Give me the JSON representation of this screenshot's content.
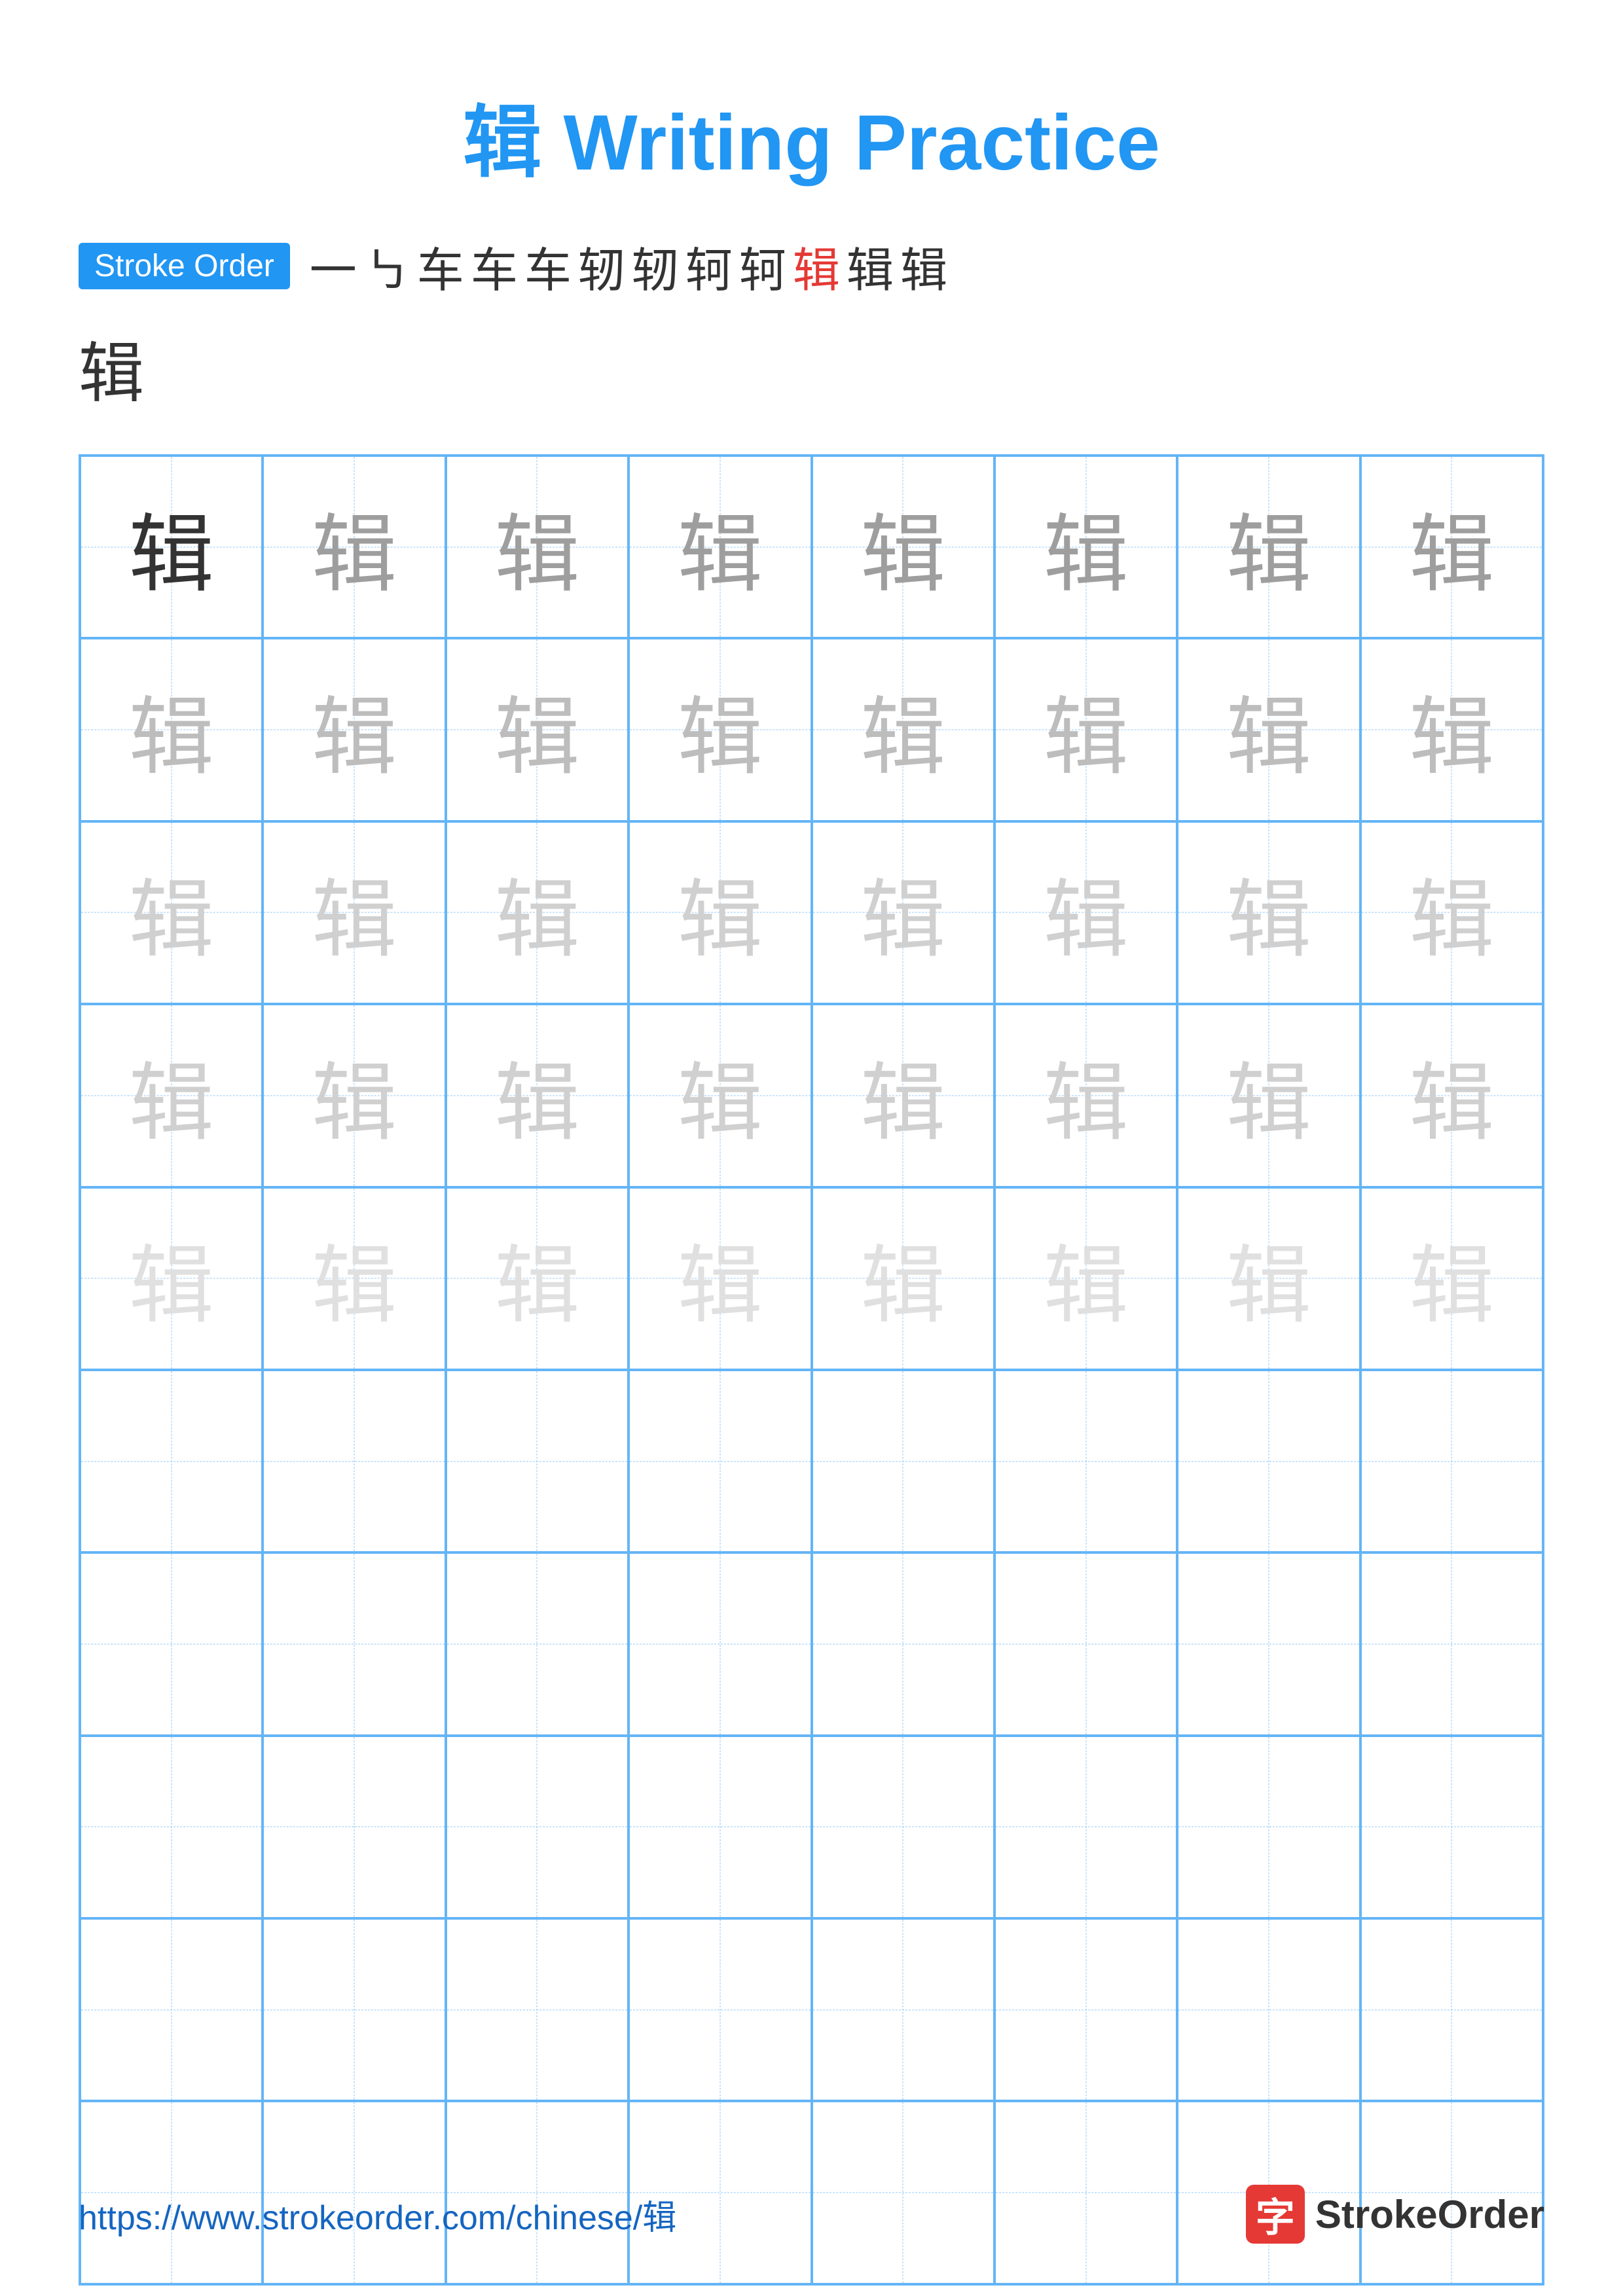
{
  "title": {
    "character": "辑",
    "label": "Writing Practice",
    "full": "辑 Writing Practice"
  },
  "stroke_order": {
    "badge_label": "Stroke Order",
    "strokes": [
      "一",
      "㇉",
      "车",
      "车",
      "车",
      "车°",
      "车°",
      "轲",
      "轲",
      "辑",
      "辑",
      "辑"
    ],
    "final_char": "辑"
  },
  "grid": {
    "rows": 10,
    "cols": 8,
    "character": "辑",
    "filled_rows": 5,
    "char_opacities": [
      [
        1,
        2,
        2,
        2,
        2,
        2,
        2,
        2
      ],
      [
        3,
        3,
        3,
        3,
        3,
        3,
        3,
        3
      ],
      [
        4,
        4,
        4,
        4,
        4,
        4,
        4,
        4
      ],
      [
        4,
        4,
        4,
        4,
        4,
        4,
        4,
        4
      ],
      [
        5,
        5,
        5,
        5,
        5,
        5,
        5,
        5
      ]
    ]
  },
  "footer": {
    "url": "https://www.strokeorder.com/chinese/辑",
    "logo_char": "字",
    "logo_text": "StrokeOrder"
  }
}
